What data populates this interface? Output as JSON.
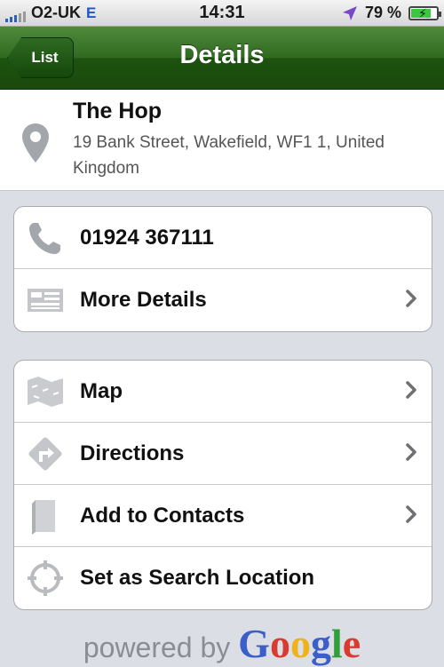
{
  "status": {
    "carrier": "O2-UK",
    "network": "E",
    "time": "14:31",
    "battery": "79 %",
    "battery_level": 0.79
  },
  "nav": {
    "back_label": "List",
    "title": "Details"
  },
  "place": {
    "name": "The Hop",
    "address": "19 Bank Street, Wakefield, WF1 1, United Kingdom"
  },
  "group1": [
    {
      "label": "01924 367111",
      "icon": "phone-icon"
    },
    {
      "label": "More Details",
      "icon": "details-icon"
    }
  ],
  "group2": [
    {
      "label": "Map",
      "icon": "map-icon"
    },
    {
      "label": "Directions",
      "icon": "directions-icon"
    },
    {
      "label": "Add to Contacts",
      "icon": "contacts-book-icon"
    },
    {
      "label": "Set as Search Location",
      "icon": "crosshair-icon"
    }
  ],
  "footer": {
    "powered_by": "powered by",
    "brand": "Google",
    "brand_colors": [
      "#3b5ec9",
      "#d83b2f",
      "#f0b21a",
      "#3b5ec9",
      "#2f9e3b",
      "#d83b2f"
    ]
  }
}
